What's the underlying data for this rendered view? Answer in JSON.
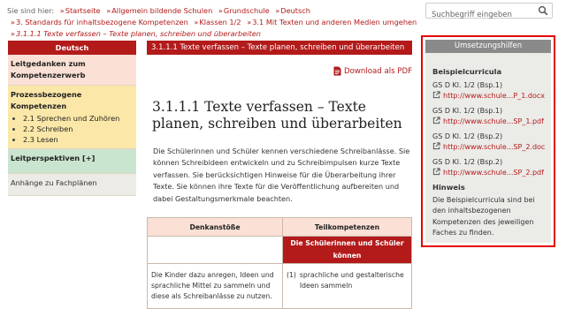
{
  "breadcrumb": {
    "prefix": "Sie sind hier:",
    "items": [
      "Startseite",
      "Allgemein bildende Schulen",
      "Grundschule",
      "Deutsch",
      "3. Standards für inhaltsbezogene Kompetenzen",
      "Klassen 1/2",
      "3.1 Mit Texten und anderen Medien umgehen"
    ],
    "current": "3.1.1.1 Texte verfassen – Texte planen, schreiben und überarbeiten",
    "separator": "»"
  },
  "search": {
    "placeholder": "Suchbegriff eingeben",
    "icon": "search-icon"
  },
  "nav": {
    "header": "Deutsch",
    "leitgedanken": "Leitgedanken zum Kompetenzerwerb",
    "prozess_title": "Prozessbezogene Kompetenzen",
    "prozess_items": [
      "2.1 Sprechen und Zuhören",
      "2.2 Schreiben",
      "2.3 Lesen"
    ],
    "leitperspektiven": "Leitperspektiven",
    "leitperspektiven_toggle": "[+]",
    "anhaenge": "Anhänge zu Fachplänen"
  },
  "main": {
    "tab_label": "3.1.1.1 Texte verfassen – Texte planen, schreiben und überarbeiten",
    "tab_caret": "▼",
    "pdf_label": "Download als PDF",
    "title": "3.1.1.1 Texte verfassen – Texte planen, schreiben und überarbeiten",
    "paragraph": "Die Schülerinnen und Schüler kennen verschiedene Schreibanlässe. Sie können Schreibideen entwickeln und zu Schreibimpulsen kurze Texte verfassen. Sie berücksichtigen Hinweise für die Überarbeitung ihrer Texte. Sie können ihre Texte für die Veröffentlichung aufbereiten und dabei Gestaltungsmerkmale beachten.",
    "table": {
      "col1": "Denkanstöße",
      "col2": "Teilkompetenzen",
      "subhead": "Die Schülerinnen und Schüler können",
      "left_text": "Die Kinder dazu anregen, Ideen und sprachliche Mittel zu sammeln und diese als Schreibanlässe zu nutzen.",
      "item_num": "(1)",
      "item_text": "sprachliche und gestalterische Ideen sammeln"
    }
  },
  "umsetzung": {
    "header": "Umsetzungshilfen",
    "beispiel_title": "Beispielcurricula",
    "links": [
      {
        "label": "GS D Kl. 1/2 (Bsp.1)",
        "url": "http://www.schule...P_1.docx"
      },
      {
        "label": "GS D Kl. 1/2 (Bsp.1)",
        "url": "http://www.schule...SP_1.pdf"
      },
      {
        "label": "GS D Kl. 1/2 (Bsp.2)",
        "url": "http://www.schule...SP_2.doc"
      },
      {
        "label": "GS D Kl. 1/2 (Bsp.2)",
        "url": "http://www.schule...SP_2.pdf"
      }
    ],
    "hinweis_title": "Hinweis",
    "hinweis_text": "Die Beispielcurricula sind bei den inhaltsbezogenen Kompetenzen des jeweiligen Faches zu finden."
  },
  "colors": {
    "accent": "#b31a1a",
    "highlight_border": "#e30000"
  }
}
